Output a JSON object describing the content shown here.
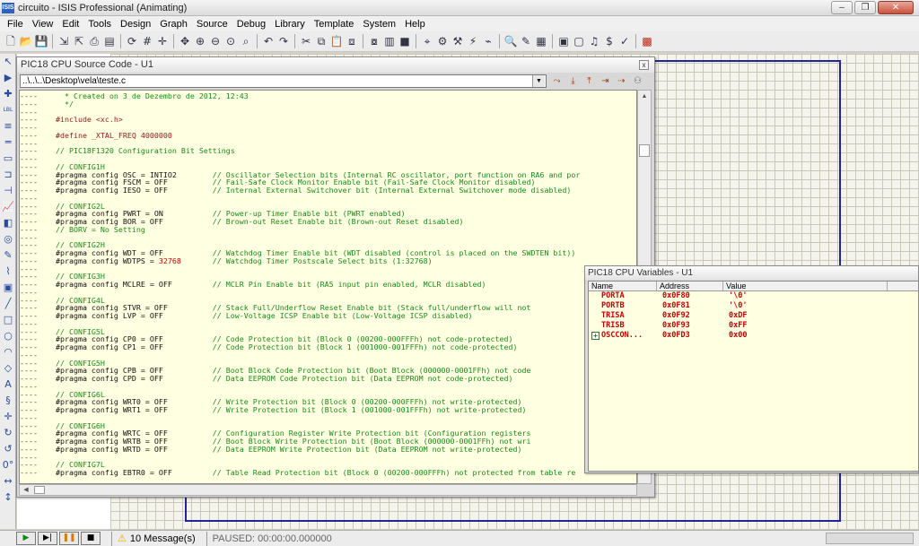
{
  "window": {
    "icon_label": "ISIS",
    "title": "circuito - ISIS Professional (Animating)",
    "minimize": "–",
    "maximize": "❐",
    "close": "✕"
  },
  "menu": [
    "File",
    "View",
    "Edit",
    "Tools",
    "Design",
    "Graph",
    "Source",
    "Debug",
    "Library",
    "Template",
    "System",
    "Help"
  ],
  "toolbar_icons": [
    "new-icon",
    "open-icon",
    "save-icon",
    "import-icon",
    "export-icon",
    "print-icon",
    "printer-setup-icon",
    "refresh-icon",
    "grid-icon",
    "origin-icon",
    "pan-icon",
    "zoom-in-icon",
    "zoom-out-icon",
    "zoom-all-icon",
    "zoom-area-icon",
    "undo-icon",
    "redo-icon",
    "cut-icon",
    "copy-icon",
    "paste-icon",
    "block-copy-icon",
    "block-move-icon",
    "block-rotate-icon",
    "block-delete-icon",
    "pick-device-icon",
    "make-device-icon",
    "packaging-icon",
    "decompose-icon",
    "wire-autorouter-icon",
    "search-icon",
    "property-tool-icon",
    "design-explorer-icon",
    "new-sheet-icon",
    "remove-sheet-icon",
    "goto-sheet-icon",
    "bom-icon",
    "erc-icon",
    "netlist-to-ares-icon"
  ],
  "left_tools": [
    "select-icon",
    "component-icon",
    "junction-icon",
    "wire-label-icon",
    "text-script-icon",
    "bus-icon",
    "subcircuit-icon",
    "terminal-icon",
    "pin-icon",
    "graph-icon",
    "tape-icon",
    "generator-icon",
    "probe-voltage-icon",
    "probe-current-icon",
    "instrument-icon",
    "line-icon",
    "box-icon",
    "circle-icon",
    "arc-icon",
    "path-icon",
    "text-icon",
    "symbol-icon",
    "marker-icon",
    "rotate-cw-icon",
    "rotate-ccw-icon",
    "angle-field-icon",
    "mirror-x-icon",
    "mirror-y-icon"
  ],
  "left_tool_glyphs": [
    "↖",
    "▶",
    "✚",
    "LBL",
    "≡",
    "═",
    "▭",
    "⊐",
    "⊣",
    "📈",
    "◧",
    "◎",
    "✎",
    "⌇",
    "▣",
    "╱",
    "□",
    "○",
    "◠",
    "◇",
    "A",
    "§",
    "✛",
    "↻",
    "↺",
    "0°",
    "↔",
    "↕"
  ],
  "source_window": {
    "title": "PIC18 CPU Source Code - U1",
    "close": "x",
    "path": "..\\..\\..\\Desktop\\vela\\teste.c",
    "code_lines": [
      {
        "m": "----",
        "parts": [
          {
            "c": "cm",
            "t": "  * Created on 3 de Dezembro de 2012, 12:43"
          }
        ]
      },
      {
        "m": "----",
        "parts": [
          {
            "c": "cm",
            "t": "  */"
          }
        ]
      },
      {
        "m": "----",
        "parts": []
      },
      {
        "m": "----",
        "parts": [
          {
            "c": "pp",
            "t": "#include <xc.h>"
          }
        ]
      },
      {
        "m": "----",
        "parts": []
      },
      {
        "m": "----",
        "parts": [
          {
            "c": "pp",
            "t": "#define _XTAL_FREQ 4000000"
          }
        ]
      },
      {
        "m": "----",
        "parts": []
      },
      {
        "m": "----",
        "parts": [
          {
            "c": "cm",
            "t": "// PIC18F1320 Configuration Bit Settings"
          }
        ]
      },
      {
        "m": "----",
        "parts": []
      },
      {
        "m": "----",
        "parts": [
          {
            "c": "cm",
            "t": "// CONFIG1H"
          }
        ]
      },
      {
        "m": "----",
        "parts": [
          {
            "c": "tx",
            "t": "#pragma config OSC = INTIO2"
          },
          {
            "c": "cm",
            "t": "        // Oscillator Selection bits (Internal RC oscillator, port function on RA6 and por"
          }
        ]
      },
      {
        "m": "----",
        "parts": [
          {
            "c": "tx",
            "t": "#pragma config FSCM = OFF"
          },
          {
            "c": "cm",
            "t": "          // Fail-Safe Clock Monitor Enable bit (Fail-Safe Clock Monitor disabled)"
          }
        ]
      },
      {
        "m": "----",
        "parts": [
          {
            "c": "tx",
            "t": "#pragma config IESO = OFF"
          },
          {
            "c": "cm",
            "t": "          // Internal External Switchover bit (Internal External Switchover mode disabled)"
          }
        ]
      },
      {
        "m": "----",
        "parts": []
      },
      {
        "m": "----",
        "parts": [
          {
            "c": "cm",
            "t": "// CONFIG2L"
          }
        ]
      },
      {
        "m": "----",
        "parts": [
          {
            "c": "tx",
            "t": "#pragma config PWRT = ON"
          },
          {
            "c": "cm",
            "t": "           // Power-up Timer Enable bit (PWRT enabled)"
          }
        ]
      },
      {
        "m": "----",
        "parts": [
          {
            "c": "tx",
            "t": "#pragma config BOR = OFF"
          },
          {
            "c": "cm",
            "t": "           // Brown-out Reset Enable bit (Brown-out Reset disabled)"
          }
        ]
      },
      {
        "m": "----",
        "parts": [
          {
            "c": "cm",
            "t": "// BORV = No Setting"
          }
        ]
      },
      {
        "m": "----",
        "parts": []
      },
      {
        "m": "----",
        "parts": [
          {
            "c": "cm",
            "t": "// CONFIG2H"
          }
        ]
      },
      {
        "m": "----",
        "parts": [
          {
            "c": "tx",
            "t": "#pragma config WDT = OFF"
          },
          {
            "c": "cm",
            "t": "           // Watchdog Timer Enable bit (WDT disabled (control is placed on the SWDTEN bit))"
          }
        ]
      },
      {
        "m": "----",
        "parts": [
          {
            "c": "tx",
            "t": "#pragma config WDTPS = "
          },
          {
            "c": "val",
            "t": "32768"
          },
          {
            "c": "cm",
            "t": "       // Watchdog Timer Postscale Select bits (1:32768)"
          }
        ]
      },
      {
        "m": "----",
        "parts": []
      },
      {
        "m": "----",
        "parts": [
          {
            "c": "cm",
            "t": "// CONFIG3H"
          }
        ]
      },
      {
        "m": "----",
        "parts": [
          {
            "c": "tx",
            "t": "#pragma config MCLRE = OFF"
          },
          {
            "c": "cm",
            "t": "         // MCLR Pin Enable bit (RA5 input pin enabled, MCLR disabled)"
          }
        ]
      },
      {
        "m": "----",
        "parts": []
      },
      {
        "m": "----",
        "parts": [
          {
            "c": "cm",
            "t": "// CONFIG4L"
          }
        ]
      },
      {
        "m": "----",
        "parts": [
          {
            "c": "tx",
            "t": "#pragma config STVR = OFF"
          },
          {
            "c": "cm",
            "t": "          // Stack Full/Underflow Reset Enable bit (Stack full/underflow will not"
          }
        ]
      },
      {
        "m": "----",
        "parts": [
          {
            "c": "tx",
            "t": "#pragma config LVP = OFF"
          },
          {
            "c": "cm",
            "t": "           // Low-Voltage ICSP Enable bit (Low-Voltage ICSP disabled)"
          }
        ]
      },
      {
        "m": "----",
        "parts": []
      },
      {
        "m": "----",
        "parts": [
          {
            "c": "cm",
            "t": "// CONFIG5L"
          }
        ]
      },
      {
        "m": "----",
        "parts": [
          {
            "c": "tx",
            "t": "#pragma config CP0 = OFF"
          },
          {
            "c": "cm",
            "t": "           // Code Protection bit (Block 0 (00200-000FFFh) not code-protected)"
          }
        ]
      },
      {
        "m": "----",
        "parts": [
          {
            "c": "tx",
            "t": "#pragma config CP1 = OFF"
          },
          {
            "c": "cm",
            "t": "           // Code Protection bit (Block 1 (001000-001FFFh) not code-protected)"
          }
        ]
      },
      {
        "m": "----",
        "parts": []
      },
      {
        "m": "----",
        "parts": [
          {
            "c": "cm",
            "t": "// CONFIG5H"
          }
        ]
      },
      {
        "m": "----",
        "parts": [
          {
            "c": "tx",
            "t": "#pragma config CPB = OFF"
          },
          {
            "c": "cm",
            "t": "           // Boot Block Code Protection bit (Boot Block (000000-0001FFh) not code"
          }
        ]
      },
      {
        "m": "----",
        "parts": [
          {
            "c": "tx",
            "t": "#pragma config CPD = OFF"
          },
          {
            "c": "cm",
            "t": "           // Data EEPROM Code Protection bit (Data EEPROM not code-protected)"
          }
        ]
      },
      {
        "m": "----",
        "parts": []
      },
      {
        "m": "----",
        "parts": [
          {
            "c": "cm",
            "t": "// CONFIG6L"
          }
        ]
      },
      {
        "m": "----",
        "parts": [
          {
            "c": "tx",
            "t": "#pragma config WRT0 = OFF"
          },
          {
            "c": "cm",
            "t": "          // Write Protection bit (Block 0 (00200-000FFFh) not write-protected)"
          }
        ]
      },
      {
        "m": "----",
        "parts": [
          {
            "c": "tx",
            "t": "#pragma config WRT1 = OFF"
          },
          {
            "c": "cm",
            "t": "          // Write Protection bit (Block 1 (001000-001FFFh) not write-protected)"
          }
        ]
      },
      {
        "m": "----",
        "parts": []
      },
      {
        "m": "----",
        "parts": [
          {
            "c": "cm",
            "t": "// CONFIG6H"
          }
        ]
      },
      {
        "m": "----",
        "parts": [
          {
            "c": "tx",
            "t": "#pragma config WRTC = OFF"
          },
          {
            "c": "cm",
            "t": "          // Configuration Register Write Protection bit (Configuration registers"
          }
        ]
      },
      {
        "m": "----",
        "parts": [
          {
            "c": "tx",
            "t": "#pragma config WRTB = OFF"
          },
          {
            "c": "cm",
            "t": "          // Boot Block Write Protection bit (Boot Block (000000-0001FFh) not wri"
          }
        ]
      },
      {
        "m": "----",
        "parts": [
          {
            "c": "tx",
            "t": "#pragma config WRTD = OFF"
          },
          {
            "c": "cm",
            "t": "          // Data EEPROM Write Protection bit (Data EEPROM not write-protected)"
          }
        ]
      },
      {
        "m": "----",
        "parts": []
      },
      {
        "m": "----",
        "parts": [
          {
            "c": "cm",
            "t": "// CONFIG7L"
          }
        ]
      },
      {
        "m": "----",
        "parts": [
          {
            "c": "tx",
            "t": "#pragma config EBTR0 = OFF"
          },
          {
            "c": "cm",
            "t": "         // Table Read Protection bit (Block 0 (00200-000FFFh) not protected from table re"
          }
        ]
      }
    ]
  },
  "variables_window": {
    "title": "PIC18 CPU Variables - U1",
    "columns": [
      "Name",
      "Address",
      "Value"
    ],
    "rows": [
      {
        "name": "PORTA",
        "address": "0x0F80",
        "value": "'\\0'",
        "expandable": false
      },
      {
        "name": "PORTB",
        "address": "0x0F81",
        "value": "'\\0'",
        "expandable": false
      },
      {
        "name": "TRISA",
        "address": "0x0F92",
        "value": "0xDF",
        "expandable": false
      },
      {
        "name": "TRISB",
        "address": "0x0F93",
        "value": "0xFF",
        "expandable": false
      },
      {
        "name": "OSCCON...",
        "address": "0x0FD3",
        "value": "0x00",
        "expandable": true
      }
    ]
  },
  "status_bar": {
    "messages": "10 Message(s)",
    "status": "PAUSED: 00:00:00.000000"
  },
  "colors": {
    "code_background": "#ffffe1",
    "comment": "#1a8a1a",
    "value_red": "#c00000",
    "sheet_border": "#23239a"
  }
}
